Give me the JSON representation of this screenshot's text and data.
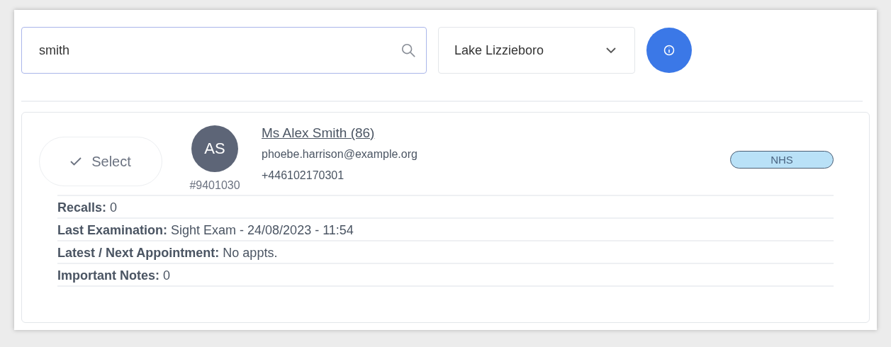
{
  "search": {
    "value": "smith"
  },
  "location_select": {
    "value": "Lake Lizzieboro"
  },
  "patient": {
    "select_label": "Select",
    "initials": "AS",
    "number": "#9401030",
    "name": "Ms Alex Smith (86)",
    "email": "phoebe.harrison@example.org",
    "phone": "+446102170301",
    "badge": "NHS",
    "details": [
      {
        "text": "**Recalls:** 0"
      },
      {
        "text": "**Last Examination:** Sight Exam - 24/08/2023 - 11:54"
      },
      {
        "text": "**Latest / Next Appointment:** No appts."
      },
      {
        "text": "**Important Notes:** 0"
      }
    ]
  }
}
